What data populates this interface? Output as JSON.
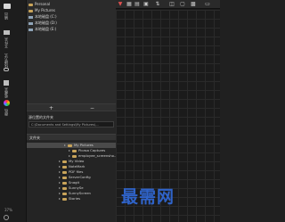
{
  "rail": {
    "labels": [
      "输出",
      "文件夹",
      "快捷方式",
      "收藏夹",
      "颜色"
    ],
    "zoom": "37%"
  },
  "folders": {
    "items": [
      {
        "label": "Personal",
        "kind": "folder"
      },
      {
        "label": "My Pictures",
        "kind": "folder"
      },
      {
        "label": "本地磁盘 (C:)",
        "kind": "drive"
      },
      {
        "label": "本地磁盘 (D:)",
        "kind": "drive"
      },
      {
        "label": "本地磁盘 (E:)",
        "kind": "drive"
      }
    ],
    "add_label": "+",
    "remove_label": "−"
  },
  "source": {
    "title": "源位置的文件夹",
    "path": "C:\\Documents and Settings\\My Pictures\\..."
  },
  "files": {
    "header": "文件夹",
    "rows": [
      {
        "label": "My Pictures",
        "selected": true
      },
      {
        "label": "Picasa Captures",
        "selected": false
      },
      {
        "label": "employee_screensho...",
        "selected": false
      },
      {
        "label": "My Video",
        "selected": false
      },
      {
        "label": "NoteMark",
        "selected": false
      },
      {
        "label": "PDF files",
        "selected": false
      },
      {
        "label": "ServerConfig",
        "selected": false
      },
      {
        "label": "Snagit",
        "selected": false
      },
      {
        "label": "SunnySe",
        "selected": false
      },
      {
        "label": "SunnyScreen",
        "selected": false
      },
      {
        "label": "Stories",
        "selected": false
      }
    ]
  },
  "toolbar": {
    "icons": [
      "filter-icon",
      "grid-icon",
      "list-icon",
      "detail-icon",
      "sort-icon",
      "compare-icon",
      "loupe-icon",
      "survey-icon",
      "map-icon"
    ]
  },
  "watermark": "最需网"
}
